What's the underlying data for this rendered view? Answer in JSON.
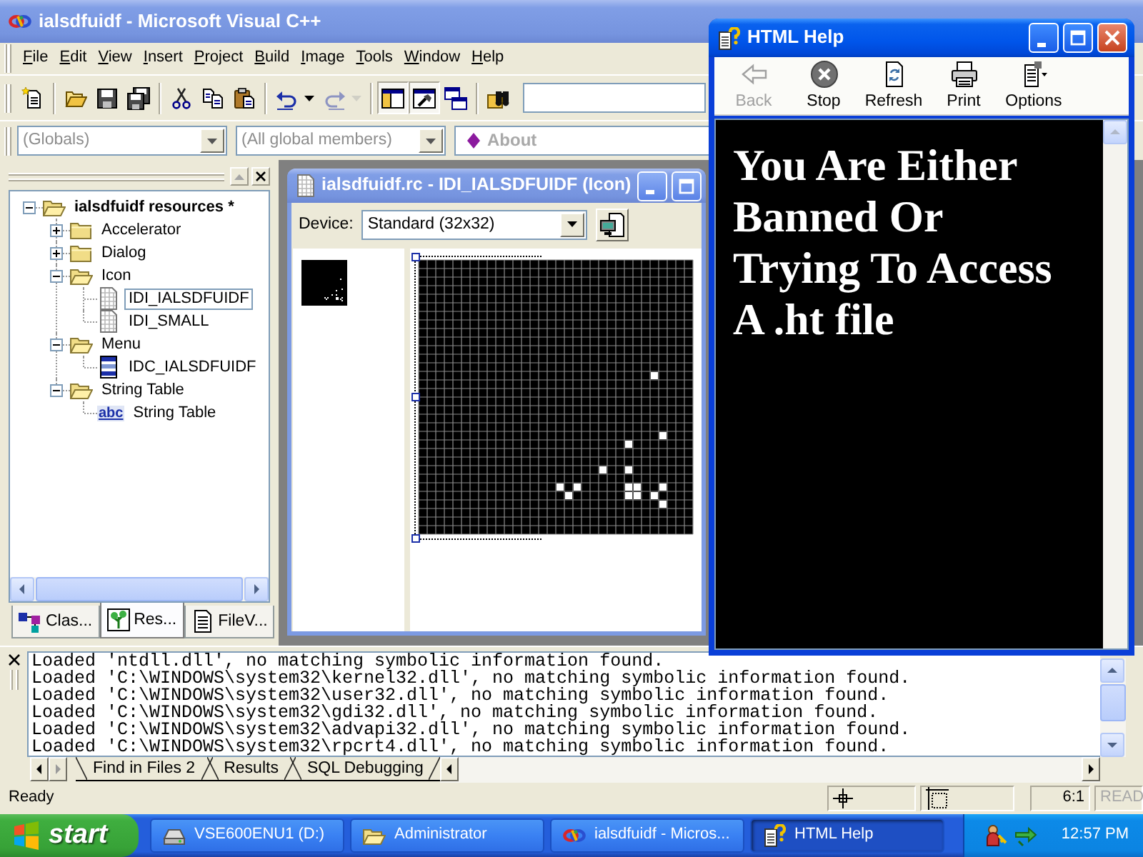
{
  "main_window": {
    "title": "ialsdfuidf - Microsoft Visual C++"
  },
  "menu": [
    {
      "label": "File"
    },
    {
      "label": "Edit"
    },
    {
      "label": "View"
    },
    {
      "label": "Insert"
    },
    {
      "label": "Project"
    },
    {
      "label": "Build"
    },
    {
      "label": "Image"
    },
    {
      "label": "Tools"
    },
    {
      "label": "Window"
    },
    {
      "label": "Help"
    }
  ],
  "standard_toolbar": {
    "groups": [
      [
        {
          "kind": "new",
          "disabled": false,
          "pressed": false
        }
      ],
      [
        {
          "kind": "open",
          "disabled": false,
          "pressed": false
        },
        {
          "kind": "save",
          "disabled": false,
          "pressed": false
        },
        {
          "kind": "save-all",
          "disabled": false,
          "pressed": false
        }
      ],
      [
        {
          "kind": "cut",
          "disabled": false,
          "pressed": false
        },
        {
          "kind": "copy",
          "disabled": false,
          "pressed": false
        },
        {
          "kind": "paste",
          "disabled": false,
          "pressed": false
        }
      ],
      [
        {
          "kind": "undo",
          "disabled": false,
          "pressed": false,
          "dropdown": true
        },
        {
          "kind": "redo",
          "disabled": true,
          "pressed": false,
          "dropdown": true
        }
      ],
      [
        {
          "kind": "workspace",
          "disabled": false,
          "pressed": true
        },
        {
          "kind": "output",
          "disabled": false,
          "pressed": true
        },
        {
          "kind": "windows",
          "disabled": false,
          "pressed": false
        }
      ],
      [
        {
          "kind": "find-in-files",
          "disabled": false,
          "pressed": false
        }
      ]
    ]
  },
  "wizard_bar": {
    "combos": [
      {
        "value": "(Globals)",
        "disabled": true
      },
      {
        "value": "(All global members)",
        "disabled": true
      }
    ],
    "action": {
      "label": "About",
      "disabled": true
    }
  },
  "workspace": {
    "tree": [
      {
        "label": "ialsdfuidf resources *",
        "kind": "folder",
        "expanded": true,
        "selected": false,
        "children": [
          {
            "label": "Accelerator",
            "kind": "folder",
            "expanded": false,
            "selected": false
          },
          {
            "label": "Dialog",
            "kind": "folder",
            "expanded": false,
            "selected": false
          },
          {
            "label": "Icon",
            "kind": "folder",
            "expanded": true,
            "selected": false,
            "children": [
              {
                "label": "IDI_IALSDFUIDF",
                "kind": "icon",
                "selected": true
              },
              {
                "label": "IDI_SMALL",
                "kind": "icon",
                "selected": false
              }
            ]
          },
          {
            "label": "Menu",
            "kind": "folder",
            "expanded": true,
            "selected": false,
            "children": [
              {
                "label": "IDC_IALSDFUIDF",
                "kind": "menu",
                "selected": false
              }
            ]
          },
          {
            "label": "String Table",
            "kind": "folder",
            "expanded": true,
            "selected": false,
            "children": [
              {
                "label": "String Table",
                "kind": "strings",
                "icon_text": "abc",
                "selected": false
              }
            ]
          }
        ]
      }
    ],
    "tabs": [
      {
        "label": "Clas...",
        "kind": "classes",
        "selected": false
      },
      {
        "label": "Res...",
        "kind": "resources",
        "selected": true
      },
      {
        "label": "FileV...",
        "kind": "files",
        "selected": false
      }
    ]
  },
  "icon_editor": {
    "title": "ialsdfuidf.rc - IDI_IALSDFUIDF (Icon)",
    "device_label": "Device:",
    "device": "Standard (32x32)"
  },
  "output": {
    "lines": [
      "Loaded 'ntdll.dll', no matching symbolic information found.",
      "Loaded 'C:\\WINDOWS\\system32\\kernel32.dll', no matching symbolic information found.",
      "Loaded 'C:\\WINDOWS\\system32\\user32.dll', no matching symbolic information found.",
      "Loaded 'C:\\WINDOWS\\system32\\gdi32.dll', no matching symbolic information found.",
      "Loaded 'C:\\WINDOWS\\system32\\advapi32.dll', no matching symbolic information found.",
      "Loaded 'C:\\WINDOWS\\system32\\rpcrt4.dll', no matching symbolic information found."
    ],
    "tabs": [
      {
        "label": "Find in Files 2",
        "selected": false
      },
      {
        "label": "Results",
        "selected": false
      },
      {
        "label": "SQL Debugging",
        "selected": false
      }
    ]
  },
  "status_bar": {
    "message": "Ready",
    "position": "6:1",
    "indicators": [
      {
        "label": "READ",
        "on": false
      }
    ]
  },
  "taskbar": {
    "start": "start",
    "tasks": [
      {
        "label": "VSE600ENU1 (D:)",
        "kind": "drive",
        "selected": false
      },
      {
        "label": "Administrator",
        "kind": "folder",
        "selected": false
      },
      {
        "label": "ialsdfuidf - Micros...",
        "kind": "app",
        "selected": false
      },
      {
        "label": "HTML Help",
        "kind": "help",
        "selected": true
      }
    ],
    "clock": "12:57 PM"
  },
  "help_window": {
    "title": "HTML Help",
    "toolbar": [
      {
        "kind": "back",
        "label": "Back",
        "disabled": true
      },
      {
        "kind": "stop",
        "label": "Stop",
        "disabled": false
      },
      {
        "kind": "refresh",
        "label": "Refresh",
        "disabled": false
      },
      {
        "kind": "print",
        "label": "Print",
        "disabled": false
      },
      {
        "kind": "options",
        "label": "Options",
        "disabled": false
      }
    ],
    "content": "You Are Either Banned Or Trying To Access A .ht file"
  }
}
